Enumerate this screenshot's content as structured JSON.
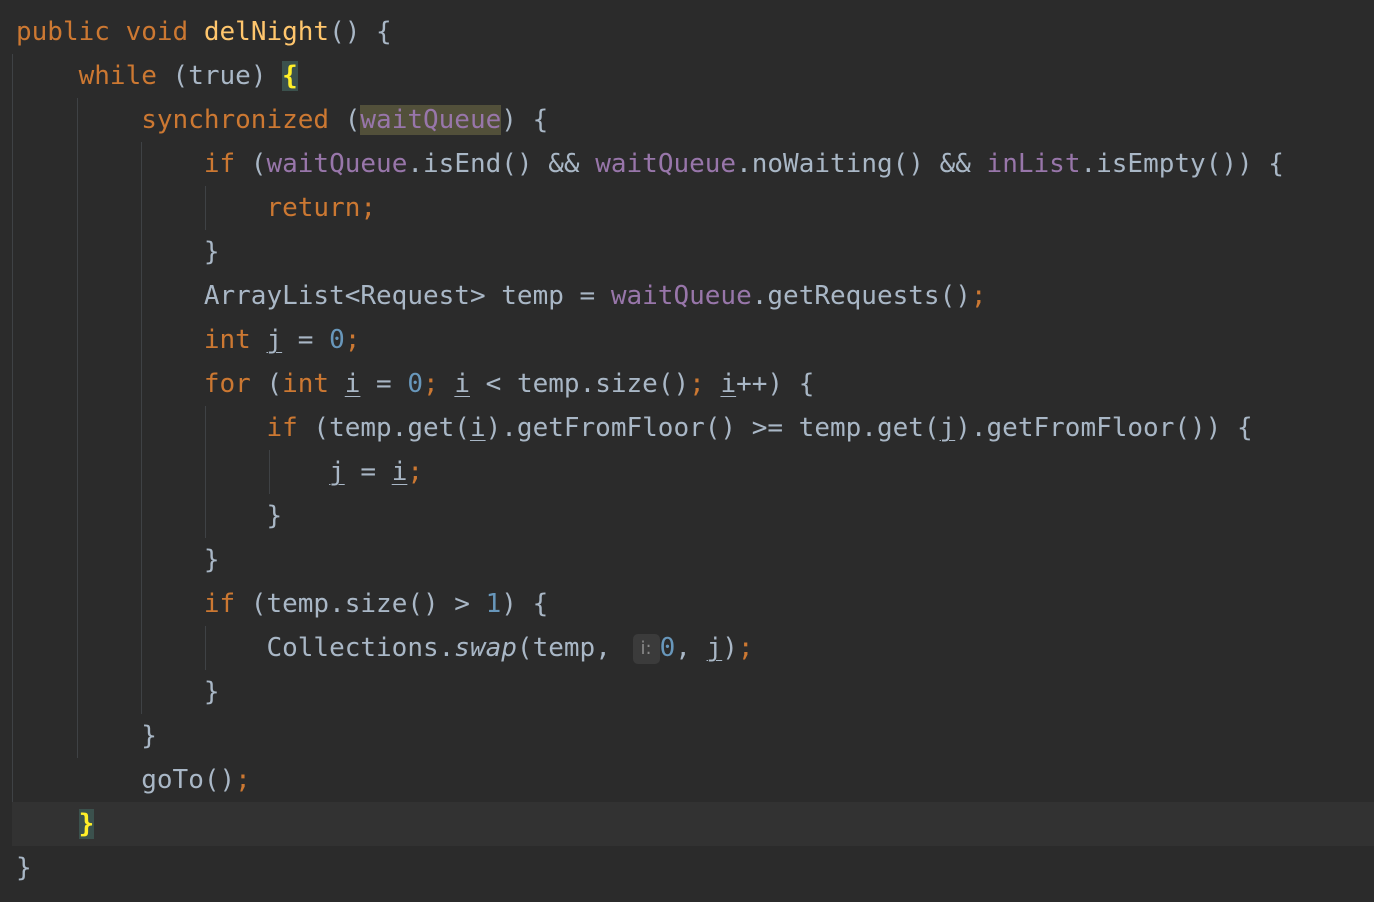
{
  "editor": {
    "method_signature": {
      "modifier": "public",
      "return_type": "void",
      "name": "delNight",
      "params": "() {"
    },
    "while_kw": "while",
    "while_cond": " (true) ",
    "open_brace": "{",
    "sync_kw": "synchronized",
    "paren_open": " (",
    "wait_queue": "waitQueue",
    "sync_tail": ") {",
    "if_kw": "if",
    "cond_open": " (",
    "is_end": ".isEnd() && ",
    "no_waiting": ".noWaiting() && ",
    "in_list": "inList",
    "is_empty": ".isEmpty()) {",
    "return_stmt": "return;",
    "close_brace": "}",
    "arraylist_decl": "ArrayList<Request> temp = ",
    "get_requests": ".getRequests()",
    "semicolon": ";",
    "int_kw": "int",
    "var_j": "j",
    "var_i": "i",
    "assign": " = ",
    "zero": "0",
    "one": "1",
    "for_kw": "for",
    "for_open": " (",
    "for_mid": " < temp.size()",
    "for_inc": "++) {",
    "temp_get_open": " (temp.get(",
    "get_from_floor_cmp": ").getFromFloor() >= temp.get(",
    "get_from_floor_end": ").getFromFloor()) {",
    "size_cond": " (temp.size() > ",
    "size_tail": ") {",
    "collections": "Collections.",
    "swap": "swap",
    "swap_args": "(temp,",
    "param_hint": "i:",
    "comma_space": ", ",
    "call_close": ")",
    "goto_call": "goTo()"
  }
}
